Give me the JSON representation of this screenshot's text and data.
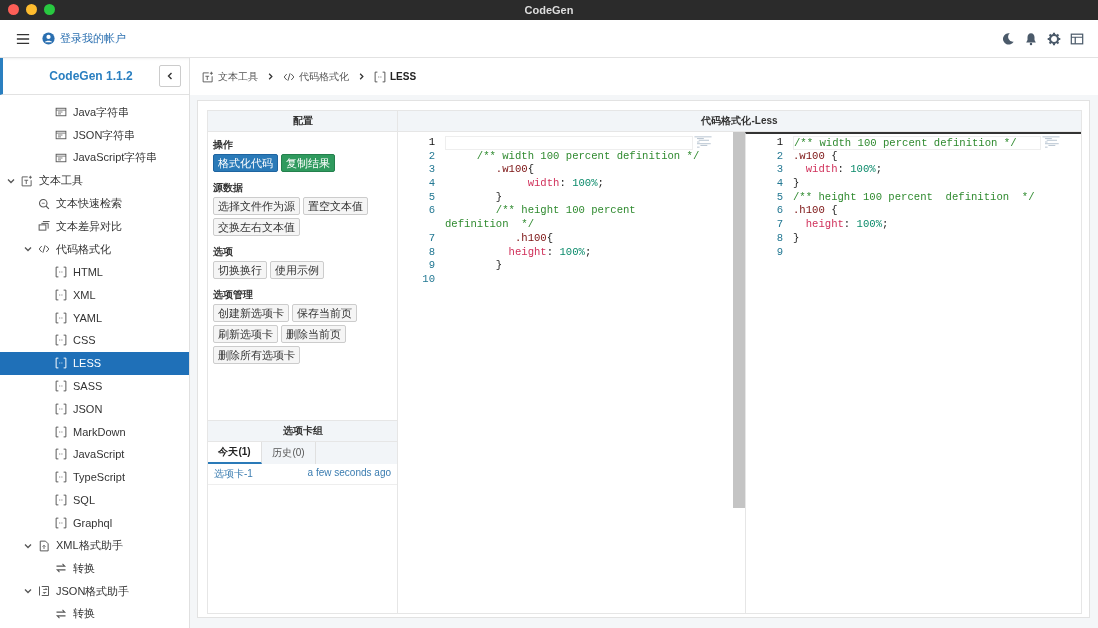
{
  "window": {
    "title": "CodeGen"
  },
  "header": {
    "account_link": "登录我的帐户"
  },
  "sidebar": {
    "brand": "CodeGen 1.1.2",
    "partial_items": [
      {
        "label": "Java字符串",
        "kind": "string",
        "selected": false
      },
      {
        "label": "JSON字符串",
        "kind": "string",
        "selected": false
      },
      {
        "label": "JavaScript字符串",
        "kind": "string",
        "selected": false
      }
    ],
    "tree": [
      {
        "label": "文本工具",
        "kind": "tool",
        "expanded": true,
        "selected": false,
        "children": [
          {
            "label": "文本快速检索",
            "kind": "search",
            "selected": false
          },
          {
            "label": "文本差异对比",
            "kind": "diff",
            "selected": false
          },
          {
            "label": "代码格式化",
            "kind": "code",
            "expanded": true,
            "selected": false,
            "children": [
              {
                "label": "HTML",
                "kind": "bracket",
                "selected": false
              },
              {
                "label": "XML",
                "kind": "bracket",
                "selected": false
              },
              {
                "label": "YAML",
                "kind": "bracket",
                "selected": false
              },
              {
                "label": "CSS",
                "kind": "bracket",
                "selected": false
              },
              {
                "label": "LESS",
                "kind": "bracket",
                "selected": true
              },
              {
                "label": "SASS",
                "kind": "bracket",
                "selected": false
              },
              {
                "label": "JSON",
                "kind": "bracket",
                "selected": false
              },
              {
                "label": "MarkDown",
                "kind": "bracket",
                "selected": false
              },
              {
                "label": "JavaScript",
                "kind": "bracket",
                "selected": false
              },
              {
                "label": "TypeScript",
                "kind": "bracket",
                "selected": false
              },
              {
                "label": "SQL",
                "kind": "bracket",
                "selected": false
              },
              {
                "label": "Graphql",
                "kind": "bracket",
                "selected": false
              }
            ]
          },
          {
            "label": "XML格式助手",
            "kind": "file",
            "expanded": true,
            "selected": false,
            "children": [
              {
                "label": "转换",
                "kind": "convert",
                "selected": false
              }
            ]
          },
          {
            "label": "JSON格式助手",
            "kind": "json",
            "expanded": true,
            "selected": false,
            "children": [
              {
                "label": "转换",
                "kind": "convert",
                "selected": false
              }
            ]
          }
        ]
      }
    ]
  },
  "breadcrumb": [
    {
      "label": "文本工具",
      "kind": "tool"
    },
    {
      "label": "代码格式化",
      "kind": "code"
    },
    {
      "label": "LESS",
      "kind": "bracket"
    }
  ],
  "config": {
    "title": "配置",
    "sections": [
      {
        "title": "操作",
        "buttons": [
          {
            "label": "格式化代码",
            "kind": "primary"
          },
          {
            "label": "复制结果",
            "kind": "success"
          }
        ]
      },
      {
        "title": "源数据",
        "buttons": [
          {
            "label": "选择文件作为源",
            "kind": "default"
          },
          {
            "label": "置空文本值",
            "kind": "default"
          },
          {
            "label": "交换左右文本值",
            "kind": "default"
          }
        ]
      },
      {
        "title": "选项",
        "buttons": [
          {
            "label": "切换换行",
            "kind": "default"
          },
          {
            "label": "使用示例",
            "kind": "default"
          }
        ]
      },
      {
        "title": "选项管理",
        "buttons": [
          {
            "label": "创建新选项卡",
            "kind": "default"
          },
          {
            "label": "保存当前页",
            "kind": "default"
          },
          {
            "label": "刷新选项卡",
            "kind": "default"
          },
          {
            "label": "删除当前页",
            "kind": "default"
          },
          {
            "label": "删除所有选项卡",
            "kind": "default"
          }
        ]
      }
    ],
    "tab_group": {
      "title": "选项卡组",
      "tabs": [
        {
          "label": "今天(1)",
          "selected": true
        },
        {
          "label": "历史(0)",
          "selected": false
        }
      ],
      "items": [
        {
          "name": "选项卡-1",
          "time": "a few seconds ago"
        }
      ]
    }
  },
  "editor": {
    "title": "代码格式化-Less",
    "source": [
      {
        "n": "1",
        "current": true
      },
      {
        "n": "2",
        "current": false,
        "tokens": [
          {
            "kind": "comment",
            "s": "     /** width 100 percent definition */"
          }
        ]
      },
      {
        "n": "3",
        "current": false,
        "tokens": [
          {
            "kind": "selector",
            "s": "        .w100"
          },
          {
            "kind": "punct",
            "s": "{"
          }
        ]
      },
      {
        "n": "4",
        "current": false,
        "tokens": [
          {
            "kind": "property",
            "s": "             width"
          },
          {
            "kind": "punct",
            "s": ": "
          },
          {
            "kind": "value",
            "s": "100%"
          },
          {
            "kind": "punct",
            "s": ";"
          }
        ]
      },
      {
        "n": "5",
        "current": false,
        "tokens": [
          {
            "kind": "punct",
            "s": "        }"
          }
        ]
      },
      {
        "n": "6",
        "current": false,
        "tokens": [
          {
            "kind": "comment",
            "s": "        /** height 100 percent"
          }
        ],
        "wrapped": [
          {
            "kind": "comment",
            "s": "definition  */"
          }
        ]
      },
      {
        "n": "7",
        "current": false,
        "tokens": [
          {
            "kind": "selector",
            "s": "           .h100"
          },
          {
            "kind": "punct",
            "s": "{"
          }
        ]
      },
      {
        "n": "8",
        "current": false,
        "tokens": [
          {
            "kind": "property",
            "s": "          height"
          },
          {
            "kind": "punct",
            "s": ": "
          },
          {
            "kind": "value",
            "s": "100%"
          },
          {
            "kind": "punct",
            "s": ";"
          }
        ]
      },
      {
        "n": "9",
        "current": false,
        "tokens": [
          {
            "kind": "punct",
            "s": "        }"
          }
        ]
      },
      {
        "n": "10",
        "current": false
      }
    ],
    "result": [
      {
        "n": "1",
        "current": true,
        "tokens": [
          {
            "kind": "comment",
            "s": "/** width 100 percent definition */"
          }
        ]
      },
      {
        "n": "2",
        "current": false,
        "tokens": [
          {
            "kind": "selector",
            "s": ".w100"
          },
          {
            "kind": "punct",
            "s": " {"
          }
        ]
      },
      {
        "n": "3",
        "current": false,
        "tokens": [
          {
            "kind": "property",
            "s": "  width"
          },
          {
            "kind": "punct",
            "s": ": "
          },
          {
            "kind": "value",
            "s": "100%"
          },
          {
            "kind": "punct",
            "s": ";"
          }
        ]
      },
      {
        "n": "4",
        "current": false,
        "tokens": [
          {
            "kind": "punct",
            "s": "}"
          }
        ]
      },
      {
        "n": "5",
        "current": false,
        "tokens": [
          {
            "kind": "comment",
            "s": "/** height 100 percent  definition  */"
          }
        ]
      },
      {
        "n": "6",
        "current": false,
        "tokens": [
          {
            "kind": "selector",
            "s": ".h100"
          },
          {
            "kind": "punct",
            "s": " {"
          }
        ]
      },
      {
        "n": "7",
        "current": false,
        "tokens": [
          {
            "kind": "property",
            "s": "  height"
          },
          {
            "kind": "punct",
            "s": ": "
          },
          {
            "kind": "value",
            "s": "100%"
          },
          {
            "kind": "punct",
            "s": ";"
          }
        ]
      },
      {
        "n": "8",
        "current": false,
        "tokens": [
          {
            "kind": "punct",
            "s": "}"
          }
        ]
      },
      {
        "n": "9",
        "current": false
      }
    ]
  }
}
